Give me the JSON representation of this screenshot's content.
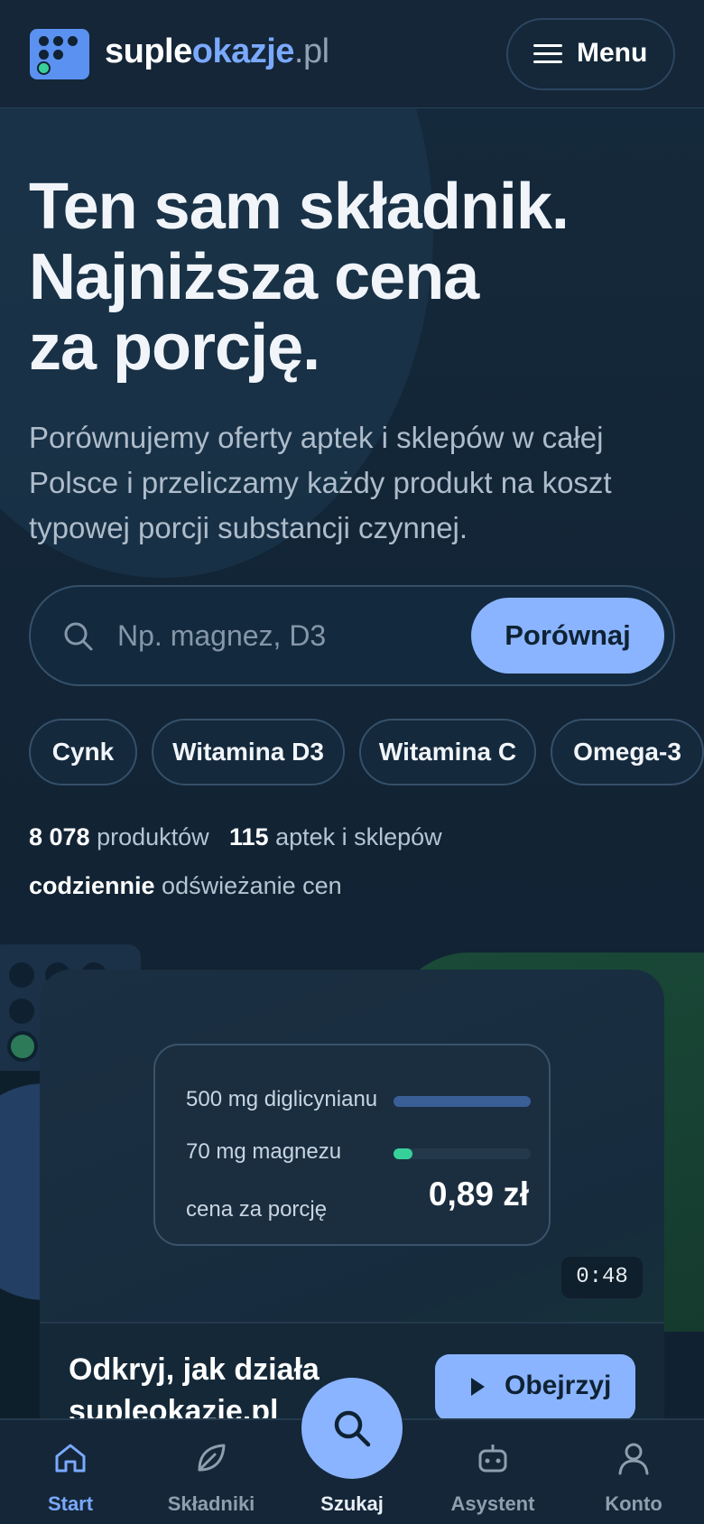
{
  "header": {
    "logo_part1": "suple",
    "logo_part2": "okazje",
    "logo_part3": ".pl",
    "menu_label": "Menu"
  },
  "hero": {
    "title_line1": "Ten sam składnik.",
    "title_line2": "Najniższa cena",
    "title_line3": "za porcję.",
    "subtitle": "Porównujemy oferty aptek i sklepów w całej Polsce i przeliczamy każdy produkt na koszt typowej porcji substancji czynnej."
  },
  "search": {
    "placeholder": "Np. magnez, D3",
    "button_label": "Porównaj"
  },
  "chips": [
    "Cynk",
    "Witamina D3",
    "Witamina C",
    "Omega-3"
  ],
  "stats": {
    "products_value": "8 078",
    "products_label": "produktów",
    "shops_value": "115",
    "shops_label": "aptek i sklepów",
    "refresh_value": "codziennie",
    "refresh_label": "odświeżanie cen"
  },
  "demo_card": {
    "row1_label": "500 mg diglicynianu",
    "row1_fill": 1.0,
    "row2_label": "70 mg magnezu",
    "row2_fill": 0.14,
    "price_label": "cena za porcję",
    "price_value": "0,89 zł",
    "timer": "0:48",
    "colors": {
      "bar1": "#3a5f96",
      "bar2": "#38d09a"
    }
  },
  "cta": {
    "title": "Odkryj, jak działa supleokazje.pl",
    "button_label": "Obejrzyj"
  },
  "bottom_nav": {
    "items": [
      {
        "label": "Start",
        "icon": "home-icon",
        "active": true
      },
      {
        "label": "Składniki",
        "icon": "leaf-icon",
        "active": false
      },
      {
        "label": "Szukaj",
        "icon": "search-icon",
        "active": false
      },
      {
        "label": "Asystent",
        "icon": "robot-icon",
        "active": false
      },
      {
        "label": "Konto",
        "icon": "user-icon",
        "active": false
      }
    ]
  },
  "colors": {
    "accent": "#8ab4ff",
    "brand_blue": "#5b91f0",
    "green": "#38d09a",
    "background": "#13283a"
  }
}
